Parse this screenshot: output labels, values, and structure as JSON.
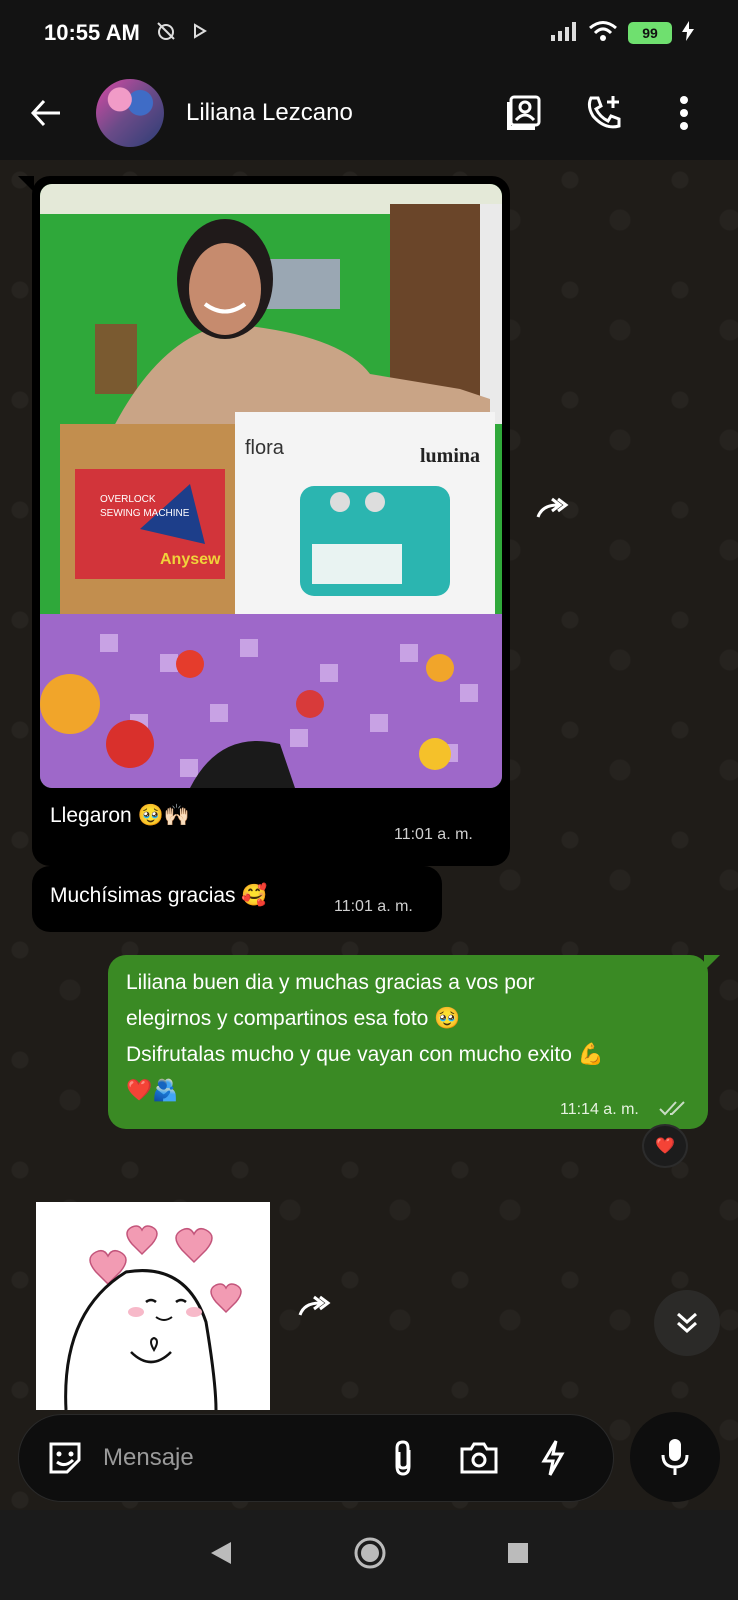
{
  "status_bar": {
    "time": "10:55 AM",
    "battery": "99"
  },
  "header": {
    "contact_name": "Liliana Lezcano"
  },
  "messages": {
    "photo_caption": "Llegaron 🥹🙌🏻",
    "photo_time": "11:01 a. m.",
    "photo_text": {
      "box_left_line1": "OVERLOCK",
      "box_left_line2": "SEWING MACHINE",
      "box_left_brand": "Anysew",
      "box_right_model": "flora",
      "box_right_brand": "lumina"
    },
    "thanks_text": "Muchísimas gracias 🥰",
    "thanks_time": "11:01 a. m.",
    "reply_line1": "Liliana buen dia y muchas gracias a vos por",
    "reply_line2": "elegirnos y compartinos esa foto 🥹",
    "reply_line3": "Dsifrutalas mucho y que vayan con mucho exito 💪",
    "reply_line4": "❤️🫂",
    "reply_time": "11:14 a. m.",
    "reaction": "❤️"
  },
  "composer": {
    "placeholder": "Mensaje"
  },
  "colors": {
    "outgoing_bubble": "#3a8a24",
    "incoming_bubble": "#000000",
    "background": "#1f1c18"
  }
}
